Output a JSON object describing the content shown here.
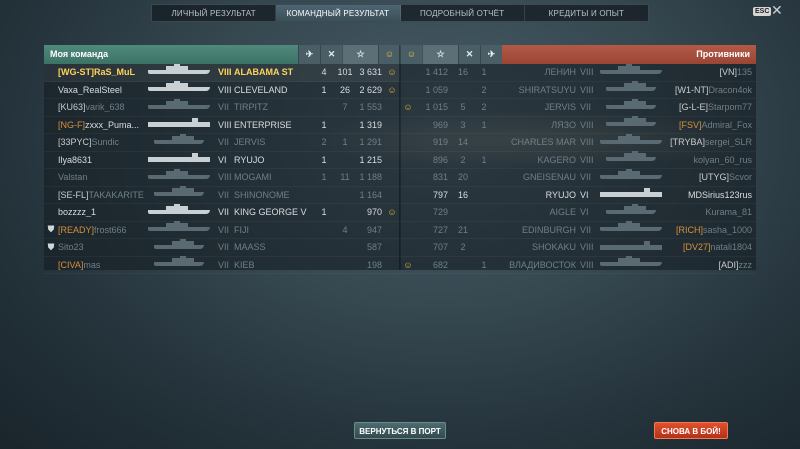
{
  "tabs": [
    "ЛИЧНЫЙ РЕЗУЛЬТАТ",
    "КОМАНДНЫЙ РЕЗУЛЬТАТ",
    "ПОДРОБНЫЙ ОТЧЁТ",
    "КРЕДИТЫ И ОПЫТ"
  ],
  "active_tab": 1,
  "esc_label": "ESC",
  "close_glyph": "✕",
  "my_team": {
    "title": "Моя команда",
    "header_icons": [
      "plane-kills-icon",
      "ship-kills-icon",
      "star-icon",
      "achievement-icon"
    ],
    "header_glyphs": [
      "✈",
      "✕",
      "☆",
      "☺"
    ],
    "rows": [
      {
        "badge": "",
        "clan": "[WG-ST]",
        "clan_color": "normal",
        "player": "RaS_MuL",
        "tier": "VIII",
        "ship": "ALABAMA ST",
        "type": "battleship",
        "v1": "4",
        "v2": "101",
        "xp": "3 631",
        "ach": "☺",
        "me": true,
        "dead": false
      },
      {
        "badge": "",
        "clan": "",
        "clan_color": "normal",
        "player": "Vaxa_RealSteel",
        "tier": "VIII",
        "ship": "CLEVELAND",
        "type": "cruiser",
        "v1": "1",
        "v2": "26",
        "xp": "2 629",
        "ach": "☺",
        "me": false,
        "dead": false
      },
      {
        "badge": "",
        "clan": "[KU63]",
        "clan_color": "normal",
        "player": "varik_638",
        "tier": "VII",
        "ship": "TIRPITZ",
        "type": "battleship",
        "v1": "",
        "v2": "7",
        "xp": "1 553",
        "ach": "",
        "me": false,
        "dead": true
      },
      {
        "badge": "",
        "clan": "[NG-F]",
        "clan_color": "orange",
        "player": "zxxx_Puma...",
        "tier": "VIII",
        "ship": "ENTERPRISE",
        "type": "carrier",
        "v1": "1",
        "v2": "",
        "xp": "1 319",
        "ach": "",
        "me": false,
        "dead": false
      },
      {
        "badge": "",
        "clan": "[33PYC]",
        "clan_color": "normal",
        "player": "Sundic",
        "tier": "VII",
        "ship": "JERVIS",
        "type": "destroyer",
        "v1": "2",
        "v2": "1",
        "xp": "1 291",
        "ach": "",
        "me": false,
        "dead": true
      },
      {
        "badge": "",
        "clan": "",
        "clan_color": "normal",
        "player": "Ilya8631",
        "tier": "VI",
        "ship": "RYUJO",
        "type": "carrier",
        "v1": "1",
        "v2": "",
        "xp": "1 215",
        "ach": "",
        "me": false,
        "dead": false
      },
      {
        "badge": "",
        "clan": "",
        "clan_color": "normal",
        "player": "Valstan",
        "tier": "VIII",
        "ship": "MOGAMI",
        "type": "cruiser",
        "v1": "1",
        "v2": "11",
        "xp": "1 188",
        "ach": "",
        "me": false,
        "dead": true
      },
      {
        "badge": "",
        "clan": "[SE-FL]",
        "clan_color": "normal",
        "player": "TAKAKARITE",
        "tier": "VII",
        "ship": "SHINONOME",
        "type": "destroyer",
        "v1": "",
        "v2": "",
        "xp": "1 164",
        "ach": "",
        "me": false,
        "dead": true
      },
      {
        "badge": "",
        "clan": "",
        "clan_color": "normal",
        "player": "bozzzz_1",
        "tier": "VII",
        "ship": "KING GEORGE V",
        "type": "battleship",
        "v1": "1",
        "v2": "",
        "xp": "970",
        "ach": "☺",
        "me": false,
        "dead": false
      },
      {
        "badge": "⛊",
        "clan": "[READY]",
        "clan_color": "orange",
        "player": "frost666",
        "tier": "VII",
        "ship": "FIJI",
        "type": "cruiser",
        "v1": "",
        "v2": "4",
        "xp": "947",
        "ach": "",
        "me": false,
        "dead": true
      },
      {
        "badge": "⛊",
        "clan": "",
        "clan_color": "normal",
        "player": "Sito23",
        "tier": "VII",
        "ship": "MAASS",
        "type": "destroyer",
        "v1": "",
        "v2": "",
        "xp": "587",
        "ach": "",
        "me": false,
        "dead": true
      },
      {
        "badge": "",
        "clan": "[CIVA]",
        "clan_color": "orange",
        "player": "mas",
        "tier": "VII",
        "ship": "KIEB",
        "type": "destroyer",
        "v1": "",
        "v2": "",
        "xp": "198",
        "ach": "",
        "me": false,
        "dead": true
      }
    ]
  },
  "enemy_team": {
    "title": "Противники",
    "header_icons": [
      "achievement-icon",
      "star-icon",
      "ship-kills-icon",
      "plane-kills-icon"
    ],
    "header_glyphs": [
      "☺",
      "☆",
      "✕",
      "✈"
    ],
    "rows": [
      {
        "ach": "",
        "xp": "1 412",
        "v2": "16",
        "v1": "1",
        "ship": "ЛЕНИН",
        "tier": "VIII",
        "type": "battleship",
        "clan": "[VN]",
        "clan_color": "normal",
        "player": "135",
        "dead": true
      },
      {
        "ach": "",
        "xp": "1 059",
        "v2": "",
        "v1": "2",
        "ship": "SHIRATSUYU",
        "tier": "VIII",
        "type": "destroyer",
        "clan": "[W1-NT]",
        "clan_color": "normal",
        "player": "Dracon4ok",
        "dead": true
      },
      {
        "ach": "☺",
        "xp": "1 015",
        "v2": "5",
        "v1": "2",
        "ship": "JERVIS",
        "tier": "VII",
        "type": "destroyer",
        "clan": "[G-L-E]",
        "clan_color": "normal",
        "player": "Starpom77",
        "dead": true
      },
      {
        "ach": "",
        "xp": "969",
        "v2": "3",
        "v1": "1",
        "ship": "ЛЯЗО",
        "tier": "VIII",
        "type": "destroyer",
        "clan": "[FSV]",
        "clan_color": "orange",
        "player": "Admiral_Fox",
        "dead": true
      },
      {
        "ach": "",
        "xp": "919",
        "v2": "14",
        "v1": "",
        "ship": "CHARLES MAR",
        "tier": "VIII",
        "type": "cruiser",
        "clan": "[TRYBA]",
        "clan_color": "normal",
        "player": "sergei_SLR",
        "dead": true
      },
      {
        "ach": "",
        "xp": "896",
        "v2": "2",
        "v1": "1",
        "ship": "KAGERO",
        "tier": "VIII",
        "type": "destroyer",
        "clan": "",
        "clan_color": "normal",
        "player": "kolyan_60_rus",
        "dead": true
      },
      {
        "ach": "",
        "xp": "831",
        "v2": "20",
        "v1": "",
        "ship": "GNEISENAU",
        "tier": "VII",
        "type": "battleship",
        "clan": "[UTYG]",
        "clan_color": "normal",
        "player": "Scvor",
        "dead": true
      },
      {
        "ach": "",
        "xp": "797",
        "v2": "16",
        "v1": "",
        "ship": "RYUJO",
        "tier": "VI",
        "type": "carrier",
        "clan": "",
        "clan_color": "normal",
        "player": "MDSirius123rus",
        "dead": false
      },
      {
        "ach": "",
        "xp": "729",
        "v2": "",
        "v1": "",
        "ship": "AIGLE",
        "tier": "VI",
        "type": "destroyer",
        "clan": "",
        "clan_color": "normal",
        "player": "Kurama_81",
        "dead": true
      },
      {
        "ach": "",
        "xp": "727",
        "v2": "21",
        "v1": "",
        "ship": "EDINBURGH",
        "tier": "VII",
        "type": "cruiser",
        "clan": "[RICH]",
        "clan_color": "orange",
        "player": "sasha_1000",
        "dead": true
      },
      {
        "ach": "",
        "xp": "707",
        "v2": "2",
        "v1": "",
        "ship": "SHOKAKU",
        "tier": "VIII",
        "type": "carrier",
        "clan": "[DV27]",
        "clan_color": "orange",
        "player": "natali1804",
        "dead": true
      },
      {
        "ach": "☺",
        "xp": "682",
        "v2": "",
        "v1": "1",
        "ship": "ВЛАДИВОСТОК",
        "tier": "VIII",
        "type": "battleship",
        "clan": "[ADI]",
        "clan_color": "normal",
        "player": "zzz",
        "dead": true
      }
    ]
  },
  "buttons": {
    "return_port": "ВЕРНУТЬСЯ В ПОРТ",
    "battle_again": "СНОВА В БОЙ!"
  }
}
